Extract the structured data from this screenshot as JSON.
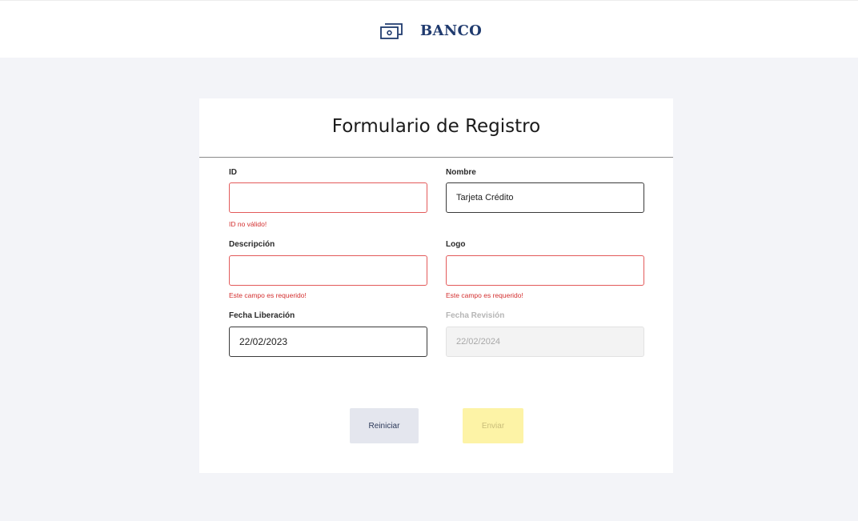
{
  "header": {
    "brand": "BANCO",
    "icon": "bank-card-icon"
  },
  "form": {
    "title": "Formulario de Registro",
    "fields": {
      "id": {
        "label": "ID",
        "value": "",
        "error": "ID no válido!"
      },
      "nombre": {
        "label": "Nombre",
        "value": "Tarjeta Crédito"
      },
      "descripcion": {
        "label": "Descripción",
        "value": "",
        "error": "Este campo es requerido!"
      },
      "logo": {
        "label": "Logo",
        "value": "",
        "error": "Este campo es requerido!"
      },
      "fecha_liberacion": {
        "label": "Fecha Liberación",
        "value": "22/02/2023"
      },
      "fecha_revision": {
        "label": "Fecha Revisión",
        "value": "22/02/2024",
        "disabled": true
      }
    },
    "buttons": {
      "reset": "Reiniciar",
      "submit": "Enviar"
    }
  },
  "colors": {
    "brand": "#1f3a6e",
    "error": "#d32f2f",
    "submit_bg": "#fdf3a6",
    "reset_bg": "#e4e6ee",
    "page_bg": "#f3f4f8"
  }
}
